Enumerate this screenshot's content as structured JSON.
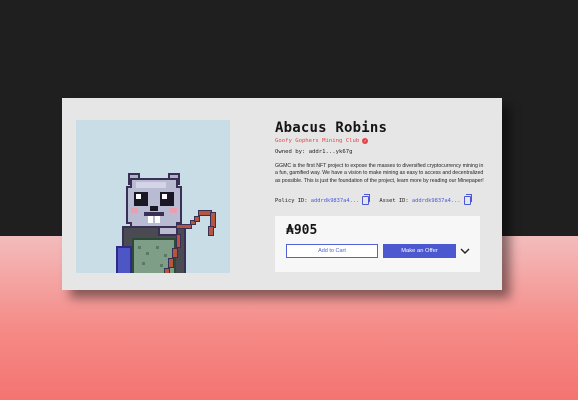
{
  "nft": {
    "title": "Abacus Robins",
    "collection": "Goofy Gophers Mining Club",
    "owner_label": "Owned by:",
    "owner_address": "addr1...yk67g",
    "description": "GGMC is the first NFT project to expose the masses to diversified cryptocurrency mining in a fun, gamified way. We have a vision to make mining as easy to access and decentralized as possible. This is just the foundation of the project, learn more by reading our Minepaper!",
    "policy_label": "Policy ID:",
    "policy_id": "addrdk9837a4...",
    "asset_label": "Asset ID:",
    "asset_id": "addrdk9837a4..."
  },
  "purchase": {
    "price": "₳905",
    "add_to_cart": "Add to Cart",
    "make_offer": "Make an Offer"
  },
  "icons": {
    "verified": "verified-badge-icon",
    "copy": "copy-icon",
    "dropdown": "chevron-down-icon"
  },
  "colors": {
    "accent": "#4b58cf",
    "collection": "#e04848",
    "card": "#e6e6e6"
  }
}
